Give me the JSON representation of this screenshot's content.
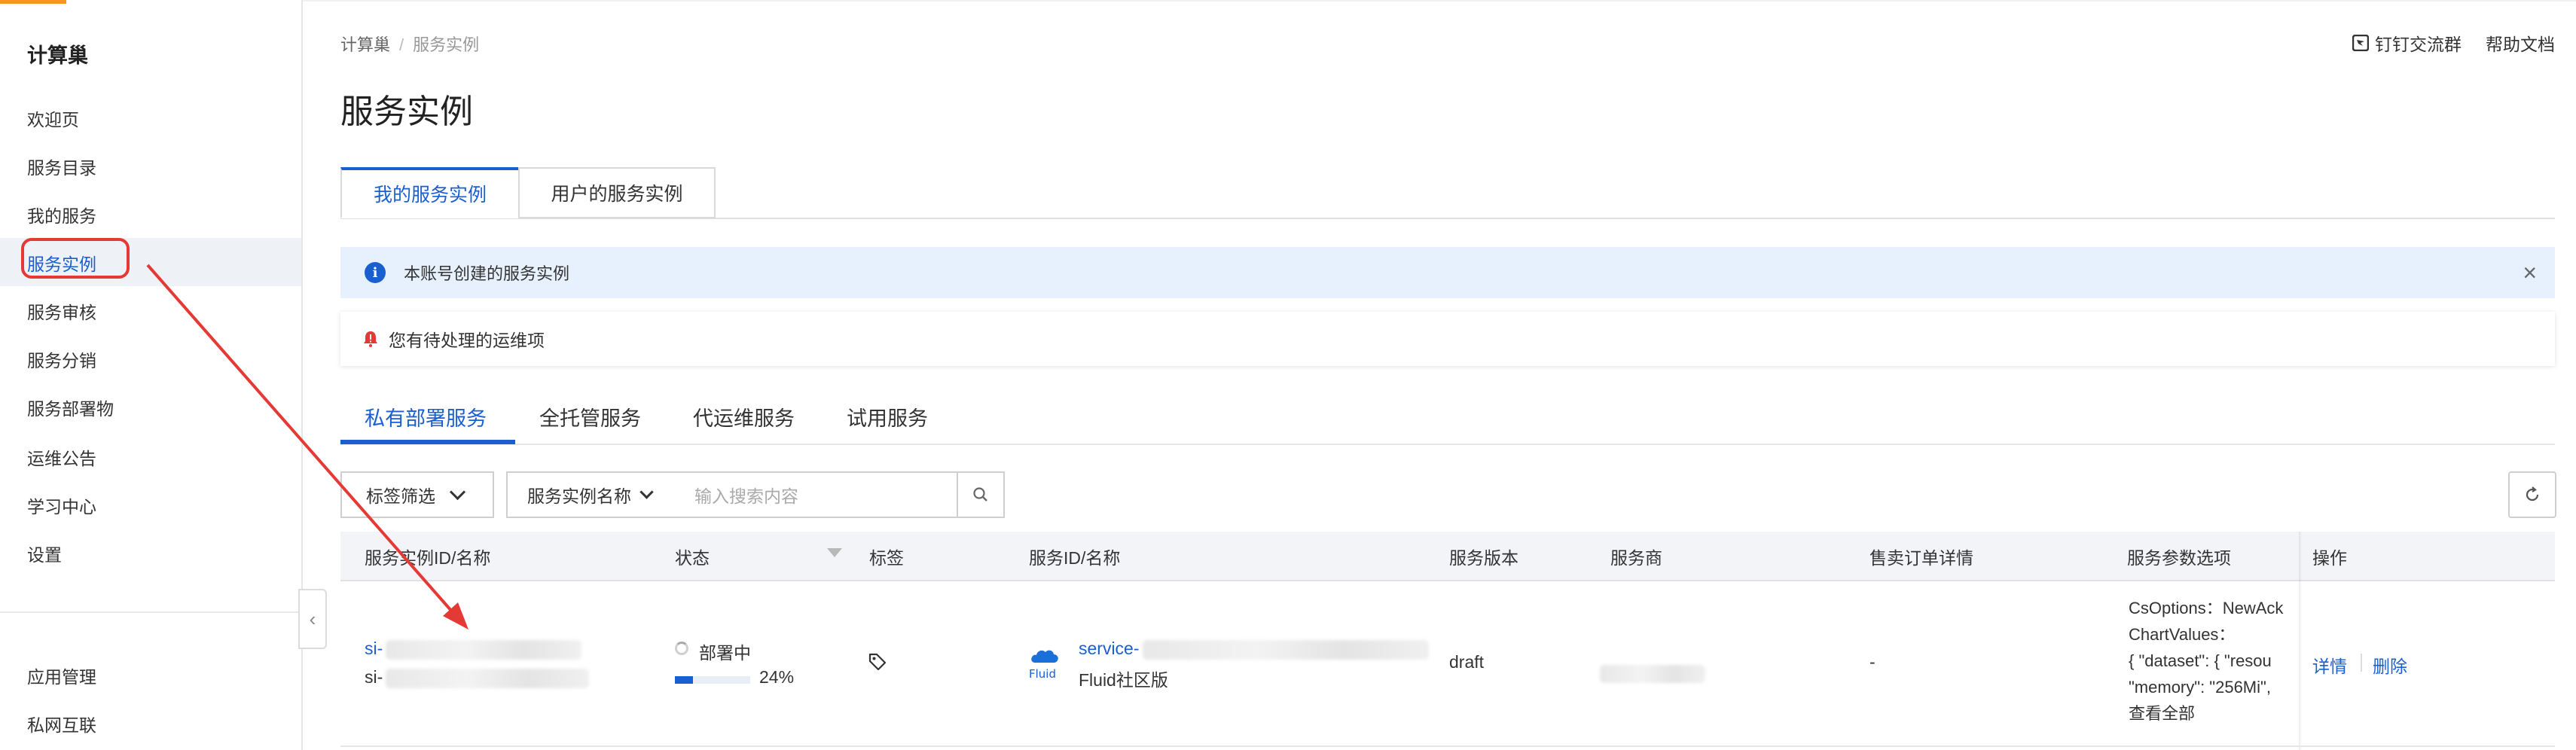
{
  "app": {
    "title": "计算巢"
  },
  "sidebar": {
    "items": [
      {
        "label": "欢迎页"
      },
      {
        "label": "服务目录"
      },
      {
        "label": "我的服务"
      },
      {
        "label": "服务实例",
        "active": true
      },
      {
        "label": "服务审核"
      },
      {
        "label": "服务分销"
      },
      {
        "label": "服务部署物"
      },
      {
        "label": "运维公告"
      },
      {
        "label": "学习中心"
      },
      {
        "label": "设置"
      }
    ],
    "bottom_items": [
      {
        "label": "应用管理"
      },
      {
        "label": "私网互联"
      }
    ],
    "collapse_icon": "chevron-left-icon"
  },
  "header": {
    "breadcrumb": [
      "计算巢",
      "服务实例"
    ],
    "links": {
      "dingtalk": "钉钉交流群",
      "help": "帮助文档"
    }
  },
  "page": {
    "title": "服务实例"
  },
  "tabs": [
    {
      "label": "我的服务实例",
      "active": true
    },
    {
      "label": "用户的服务实例"
    }
  ],
  "info_banner": {
    "text": "本账号创建的服务实例",
    "icon": "info-icon"
  },
  "warn_banner": {
    "text": "您有待处理的运维项",
    "icon": "bell-alert-icon"
  },
  "subtabs": [
    {
      "label": "私有部署服务",
      "active": true
    },
    {
      "label": "全托管服务"
    },
    {
      "label": "代运维服务"
    },
    {
      "label": "试用服务"
    }
  ],
  "filters": {
    "tag_filter": "标签筛选",
    "name_select": "服务实例名称",
    "search_placeholder": "输入搜索内容"
  },
  "table": {
    "columns": [
      "服务实例ID/名称",
      "状态",
      "标签",
      "服务ID/名称",
      "服务版本",
      "服务商",
      "售卖订单详情",
      "服务参数选项",
      "操作"
    ],
    "rows": [
      {
        "instance_id_prefix": "si-",
        "instance_name_prefix": "si-",
        "status": "部署中",
        "progress_text": "24%",
        "progress": 0.24,
        "service_id_prefix": "service-",
        "service_name": "Fluid社区版",
        "service_logo_text": "Fluid",
        "version": "draft",
        "order_detail": "-",
        "params": [
          "CsOptions：NewAck",
          "ChartValues：",
          "{ \"dataset\": { \"resou",
          "\"memory\": \"256Mi\","
        ],
        "params_view_all": "查看全部",
        "actions": {
          "detail": "详情",
          "delete": "删除"
        }
      }
    ]
  },
  "colors": {
    "accent": "#1a5fd0",
    "annotation_red": "#e53935",
    "brand_orange": "#f7941d"
  }
}
